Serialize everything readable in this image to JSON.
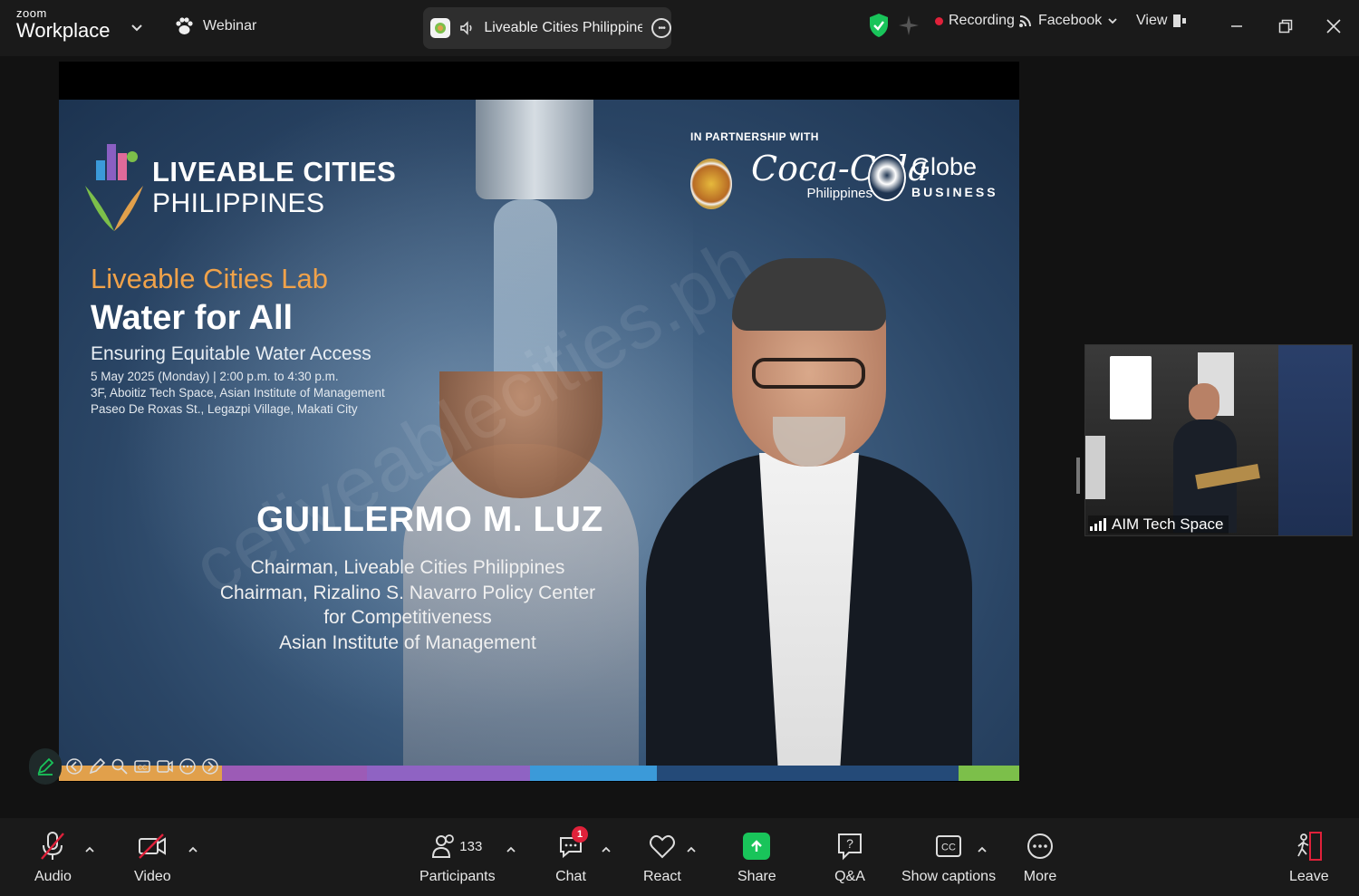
{
  "titlebar": {
    "brand_top": "zoom",
    "brand_main": "Workplace",
    "webinar_label": "Webinar",
    "meeting_title": "Liveable Cities Philippines - I",
    "recording_label": "Recording",
    "facebook_label": "Facebook",
    "view_label": "View"
  },
  "slide": {
    "brand_line1": "LIVEABLE CITIES",
    "brand_line2": "PHILIPPINES",
    "partners_label": "IN PARTNERSHIP WITH",
    "coke_script": "Coca-Cola",
    "coke_region": "Philippines",
    "globe_name": "Globe",
    "globe_sub": "BUSINESS",
    "lab_title": "Liveable Cities Lab",
    "headline": "Water for All",
    "subheadline": "Ensuring Equitable Water Access",
    "date_line": "5 May 2025 (Monday) | 2:00 p.m. to 4:30 p.m.",
    "venue_line1": "3F, Aboitiz Tech Space, Asian Institute of Management",
    "venue_line2": "Paseo De Roxas St., Legazpi Village, Makati City",
    "speaker_name": "GUILLERMO M. LUZ",
    "speaker_titles": [
      "Chairman, Liveable Cities Philippines",
      "Chairman, Rizalino S. Navarro Policy Center",
      "for Competitiveness",
      "Asian Institute of Management"
    ],
    "watermark": "celiveablecities.ph",
    "color_bar": [
      "#e1a04b",
      "#9c5bb6",
      "#8f63c3",
      "#3b9ad9",
      "#244a78",
      "#7cbf4a"
    ]
  },
  "thumbnail": {
    "label": "AIM Tech Space"
  },
  "toolbar": {
    "audio": "Audio",
    "video": "Video",
    "participants": "Participants",
    "participants_count": "133",
    "chat": "Chat",
    "chat_badge": "1",
    "react": "React",
    "share": "Share",
    "qa": "Q&A",
    "captions": "Show captions",
    "more": "More",
    "leave": "Leave"
  },
  "colors": {
    "accent_green": "#19c45a",
    "record_red": "#e0213a",
    "slide_orange": "#f0a24a"
  }
}
